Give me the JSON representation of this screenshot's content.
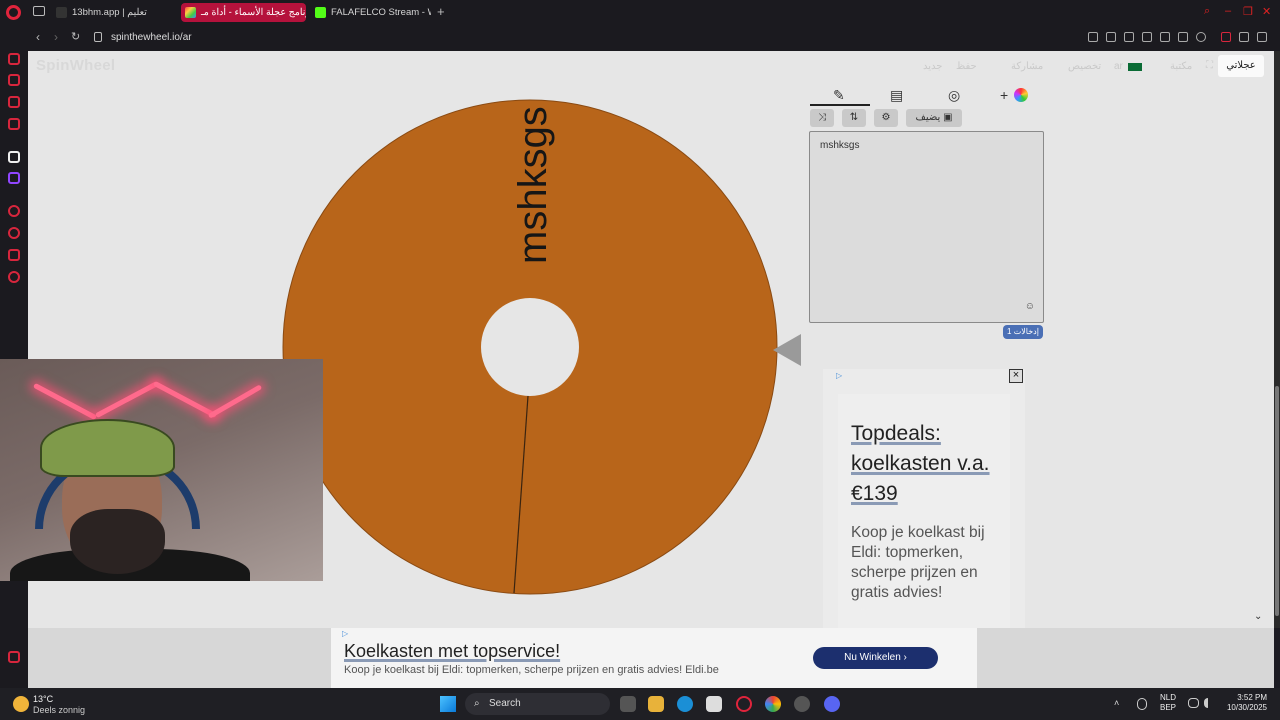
{
  "browser": {
    "tabs": [
      {
        "label": "13bhm.app | تعليم",
        "active": false
      },
      {
        "label": "برنامج عجلة الأسماء - أداة مـ",
        "active": true
      },
      {
        "label": "FALAFELCO Stream - Wat",
        "active": false
      }
    ],
    "url": "spinthewheel.io/ar"
  },
  "site": {
    "logo": "SpinWheel",
    "topnav": {
      "my_wheels": "عجلاتي",
      "items": [
        "جديد",
        "حفظ",
        "مشاركة",
        "تخصيص",
        "ar",
        "مكتبة"
      ]
    }
  },
  "wheel": {
    "entry_label": "mshksgs",
    "segment_color": "#b8651a"
  },
  "editor": {
    "tabs": [
      "pencil-icon",
      "clipboard-icon",
      "eye-off-icon",
      "color-icon"
    ],
    "add_image_label": "يضيف",
    "entries_text": "mshksgs",
    "entries_count": "إدخالات 1"
  },
  "side_ad": {
    "title": "Topdeals: koelkasten v.a. €139",
    "body": "Koop je koelkast bij Eldi: topmerken, scherpe prijzen en gratis advies!",
    "close": "×"
  },
  "bottom_ad": {
    "title": "Koelkasten met topservice!",
    "description": "Koop je koelkast bij Eldi: topmerken, scherpe prijzen en gratis advies! Eldi.be",
    "button": "Nu Winkelen ›"
  },
  "taskbar": {
    "temperature": "13°C",
    "weather": "Deels zonnig",
    "search": "Search",
    "lang_line1": "NLD",
    "lang_line2": "BEP",
    "time": "3:52 PM",
    "date": "10/30/2025"
  }
}
